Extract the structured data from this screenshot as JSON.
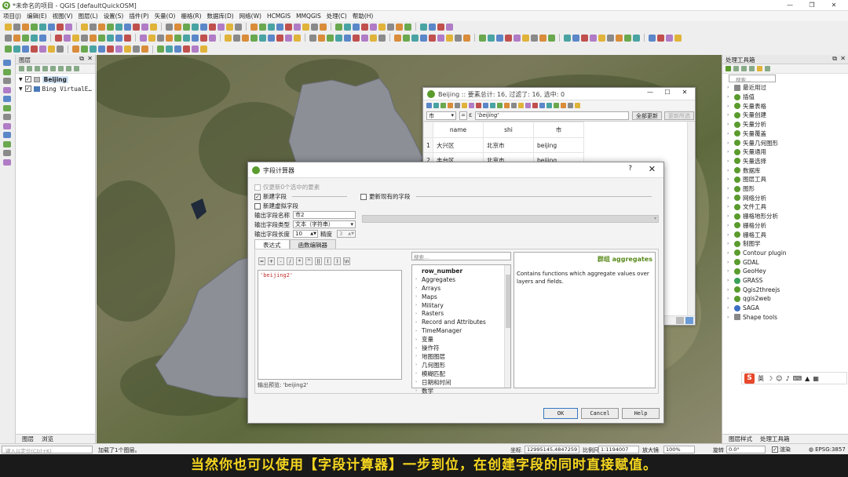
{
  "window": {
    "title": "*未命名的项目 - QGIS [defaultQuickOSM]",
    "icon": "qgis-logo-icon"
  },
  "menu": [
    "项目(J)",
    "编辑(E)",
    "视图(V)",
    "图层(L)",
    "设置(S)",
    "插件(P)",
    "矢量(O)",
    "栅格(R)",
    "数据库(D)",
    "网络(W)",
    "HCMGIS",
    "MMQGIS",
    "处理(C)",
    "帮助(H)"
  ],
  "layers_panel": {
    "title": "图层",
    "layers": [
      {
        "name": "Beijing",
        "checked": true,
        "bold": true
      },
      {
        "name": "Bing VirtualE…",
        "checked": true,
        "bold": false
      }
    ],
    "bottom_tabs": [
      "图层",
      "浏览"
    ]
  },
  "toolbox": {
    "title": "处理工具箱",
    "search_placeholder": "搜索...",
    "items": [
      {
        "label": "最近用过",
        "icon": "clock-icon"
      },
      {
        "label": "插值",
        "icon": "qgis-icon"
      },
      {
        "label": "矢量表格",
        "icon": "qgis-icon"
      },
      {
        "label": "矢量创建",
        "icon": "qgis-icon"
      },
      {
        "label": "矢量分析",
        "icon": "qgis-icon"
      },
      {
        "label": "矢量覆盖",
        "icon": "qgis-icon"
      },
      {
        "label": "矢量几何图形",
        "icon": "qgis-icon"
      },
      {
        "label": "矢量通用",
        "icon": "qgis-icon"
      },
      {
        "label": "矢量选择",
        "icon": "qgis-icon"
      },
      {
        "label": "数据库",
        "icon": "qgis-icon"
      },
      {
        "label": "图层工具",
        "icon": "qgis-icon"
      },
      {
        "label": "图形",
        "icon": "qgis-icon"
      },
      {
        "label": "网络分析",
        "icon": "qgis-icon"
      },
      {
        "label": "文件工具",
        "icon": "qgis-icon"
      },
      {
        "label": "栅格地形分析",
        "icon": "qgis-icon"
      },
      {
        "label": "栅格分析",
        "icon": "qgis-icon"
      },
      {
        "label": "栅格工具",
        "icon": "qgis-icon"
      },
      {
        "label": "制图学",
        "icon": "qgis-icon"
      },
      {
        "label": "Contour plugin",
        "icon": "contour-icon"
      },
      {
        "label": "GDAL",
        "icon": "gdal-icon"
      },
      {
        "label": "GeoHey",
        "icon": "geohey-icon"
      },
      {
        "label": "GRASS",
        "icon": "grass-icon"
      },
      {
        "label": "Qgis2threejs",
        "icon": "qgis-icon"
      },
      {
        "label": "qgis2web",
        "icon": "qgis-icon"
      },
      {
        "label": "SAGA",
        "icon": "saga-icon"
      },
      {
        "label": "Shape tools",
        "icon": "shape-tools-icon"
      }
    ],
    "bottom_tabs": [
      "图层样式",
      "处理工具箱"
    ]
  },
  "ime": {
    "logo": "S",
    "mode": "英"
  },
  "statusbar": {
    "locator_placeholder": "键入以定位(Ctrl+K)",
    "message": "加载了1个图层。",
    "coord_label": "坐标",
    "coord_value": "12995145,4847259",
    "scale_label": "比例尺",
    "scale_value": "1:1194007",
    "magnifier_label": "放大镜",
    "magnifier_value": "100%",
    "rotation_label": "旋转",
    "rotation_value": "0.0°",
    "render_label": "渲染",
    "crs": "EPSG:3857"
  },
  "attribute_table": {
    "title": "Beijing :: 要素总计: 16, 过滤了: 16, 选中: 0",
    "field_select": "市",
    "expression": "'beijing'",
    "update_all_label": "全部更新",
    "update_selected_label": "更新所选",
    "columns": [
      "name",
      "shi",
      "市"
    ],
    "rows": [
      {
        "num": "1",
        "name": "大兴区",
        "shi": "北京市",
        "shi_cn": "beijing"
      },
      {
        "num": "2",
        "name": "丰台区",
        "shi": "北京市",
        "shi_cn": "beijing"
      }
    ]
  },
  "field_calculator": {
    "title": "字段计算器",
    "only_selected_label": "仅更新0个选中的要素",
    "create_new_field_label": "新建字段",
    "create_new_field_checked": true,
    "virtual_field_label": "新建虚拟字段",
    "update_existing_label": "更新现有的字段",
    "output_name_label": "输出字段名称",
    "output_name_value": "市2",
    "output_type_label": "输出字段类型",
    "output_type_value": "文本（字符串）",
    "output_length_label": "输出字段长度",
    "output_length_value": "10",
    "precision_label": "精度",
    "precision_value": "3",
    "tabs": [
      "表达式",
      "函数编辑器"
    ],
    "operators": [
      "=",
      "+",
      "-",
      "/",
      "*",
      "^",
      "||",
      "(",
      ")",
      "\\n"
    ],
    "expression": "'beijing2'",
    "preview_label": "输出预览:",
    "preview_value": "'beijing2'",
    "func_search_placeholder": "搜索...",
    "functions": [
      {
        "label": "row_number",
        "bold": true,
        "expandable": false
      },
      {
        "label": "Aggregates",
        "bold": false,
        "expandable": true
      },
      {
        "label": "Arrays",
        "bold": false,
        "expandable": true
      },
      {
        "label": "Maps",
        "bold": false,
        "expandable": true
      },
      {
        "label": "Military",
        "bold": false,
        "expandable": true
      },
      {
        "label": "Rasters",
        "bold": false,
        "expandable": true
      },
      {
        "label": "Record and Attributes",
        "bold": false,
        "expandable": true
      },
      {
        "label": "TimeManager",
        "bold": false,
        "expandable": true
      },
      {
        "label": "变量",
        "bold": false,
        "expandable": true
      },
      {
        "label": "操作符",
        "bold": false,
        "expandable": true
      },
      {
        "label": "地图图层",
        "bold": false,
        "expandable": true
      },
      {
        "label": "几何图形",
        "bold": false,
        "expandable": true
      },
      {
        "label": "模糊匹配",
        "bold": false,
        "expandable": true
      },
      {
        "label": "日期和时间",
        "bold": false,
        "expandable": true
      },
      {
        "label": "数学",
        "bold": false,
        "expandable": true
      }
    ],
    "help_group_title": "群组 aggregates",
    "help_group_desc": "Contains functions which aggregate values over layers and fields.",
    "ok_label": "OK",
    "cancel_label": "Cancel",
    "help_label": "Help"
  },
  "subtitle": "当然你也可以使用【字段计算器】一步到位，在创建字段的同时直接赋值。",
  "colors": {
    "qgis_green": "#5a9b2d",
    "subtitle_yellow": "#f5d61f",
    "map_water": "#8c8f96"
  }
}
